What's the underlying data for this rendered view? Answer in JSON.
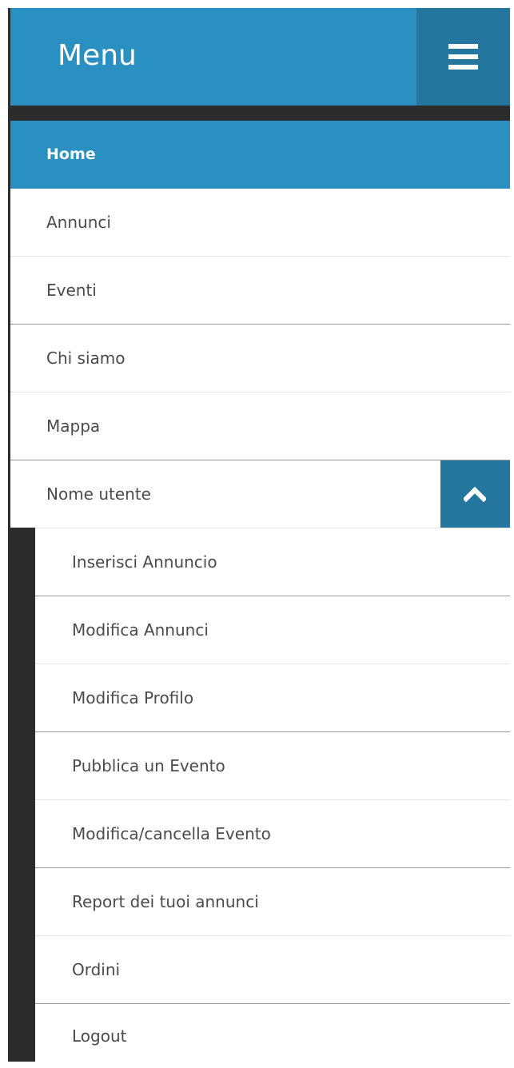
{
  "header": {
    "title": "Menu",
    "toggle_icon": "hamburger-icon"
  },
  "nav": {
    "items": [
      {
        "label": "Home",
        "active": true
      },
      {
        "label": "Annunci"
      },
      {
        "label": "Eventi"
      },
      {
        "label": "Chi siamo"
      },
      {
        "label": "Mappa"
      },
      {
        "label": "Nome utente",
        "expanded": true,
        "expand_icon": "chevron-up-icon"
      }
    ],
    "submenu": [
      {
        "label": "Inserisci Annuncio"
      },
      {
        "label": "Modifica Annunci"
      },
      {
        "label": "Modifica Profilo"
      },
      {
        "label": "Pubblica un Evento"
      },
      {
        "label": "Modifica/cancella Evento"
      },
      {
        "label": "Report dei tuoi annunci"
      },
      {
        "label": "Ordini"
      },
      {
        "label": "Logout"
      }
    ]
  },
  "colors": {
    "accent": "#2a8fc1",
    "accent_dark": "#25769f",
    "rail": "#2c2c2c",
    "text": "#4a4a4a"
  }
}
